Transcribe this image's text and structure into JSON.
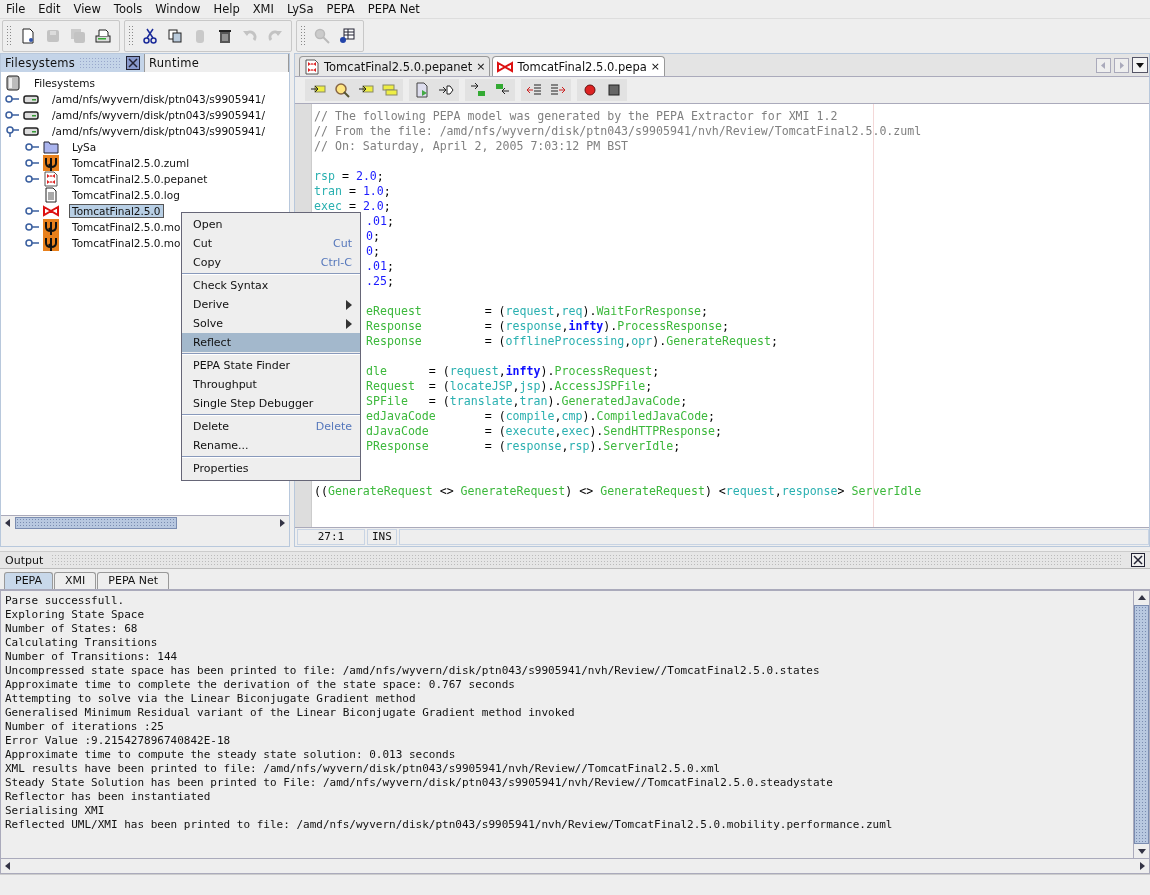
{
  "menubar": [
    "File",
    "Edit",
    "View",
    "Tools",
    "Window",
    "Help",
    "XMI",
    "LySa",
    "PEPA",
    "PEPA Net"
  ],
  "toolbar": {
    "groups": [
      {
        "items": [
          {
            "kind": "new",
            "disabled": false
          },
          {
            "kind": "save",
            "disabled": true
          },
          {
            "kind": "save-all",
            "disabled": true
          },
          {
            "kind": "print",
            "disabled": false
          }
        ]
      },
      {
        "items": [
          {
            "kind": "cut",
            "disabled": false
          },
          {
            "kind": "copy",
            "disabled": false
          },
          {
            "kind": "paste",
            "disabled": true
          },
          {
            "kind": "delete",
            "disabled": false
          },
          {
            "kind": "undo",
            "disabled": true
          },
          {
            "kind": "redo",
            "disabled": true
          }
        ]
      },
      {
        "items": [
          {
            "kind": "find",
            "disabled": true
          },
          {
            "kind": "properties",
            "disabled": false
          }
        ]
      }
    ]
  },
  "explorer": {
    "tabs": [
      {
        "label": "Filesystems",
        "selected": true
      },
      {
        "label": "Runtime",
        "selected": false
      }
    ],
    "tree": [
      {
        "label": "Filesystems",
        "kind": "root",
        "selected": false,
        "children": [
          {
            "label": "/amd/nfs/wyvern/disk/ptn043/s9905941/",
            "kind": "drive",
            "expandable": true,
            "expanded": false,
            "selected": false
          },
          {
            "label": "/amd/nfs/wyvern/disk/ptn043/s9905941/",
            "kind": "drive",
            "expandable": true,
            "expanded": false,
            "selected": false
          },
          {
            "label": "/amd/nfs/wyvern/disk/ptn043/s9905941/",
            "kind": "drive",
            "expandable": true,
            "expanded": true,
            "selected": false,
            "children": [
              {
                "label": "LySa",
                "kind": "folder",
                "expandable": true,
                "expanded": false,
                "selected": false
              },
              {
                "label": "TomcatFinal2.5.0.zuml",
                "kind": "zuml",
                "expandable": true,
                "expanded": false,
                "selected": false
              },
              {
                "label": "TomcatFinal2.5.0.pepanet",
                "kind": "pepanet",
                "expandable": true,
                "expanded": false,
                "selected": false
              },
              {
                "label": "TomcatFinal2.5.0.log",
                "kind": "log",
                "expandable": false,
                "expanded": false,
                "selected": false
              },
              {
                "label": "TomcatFinal2.5.0",
                "kind": "pepa",
                "expandable": true,
                "expanded": false,
                "selected": true
              },
              {
                "label": "TomcatFinal2.5.0.mo",
                "kind": "zuml",
                "expandable": true,
                "expanded": false,
                "selected": false
              },
              {
                "label": "TomcatFinal2.5.0.mo",
                "kind": "zuml",
                "expandable": true,
                "expanded": false,
                "selected": false
              }
            ]
          }
        ]
      }
    ]
  },
  "editor": {
    "tabs": [
      {
        "label": "TomcatFinal2.5.0.pepanet",
        "kind": "pepanet",
        "close": "×",
        "selected": false
      },
      {
        "label": "TomcatFinal2.5.0.pepa",
        "kind": "pepa",
        "close": "×",
        "selected": true
      }
    ],
    "toolbar": [
      {
        "items": [
          {
            "kind": "arrow-tag"
          },
          {
            "kind": "magnifier"
          },
          {
            "kind": "arrow-tag"
          },
          {
            "kind": "stack"
          }
        ]
      },
      {
        "items": [
          {
            "kind": "page-arrow"
          },
          {
            "kind": "arrow-play"
          }
        ]
      },
      {
        "items": [
          {
            "kind": "arrow-down"
          },
          {
            "kind": "arrow-up"
          }
        ]
      },
      {
        "items": [
          {
            "kind": "indent-left"
          },
          {
            "kind": "indent-right"
          }
        ]
      },
      {
        "items": [
          {
            "kind": "record"
          },
          {
            "kind": "stop"
          }
        ]
      }
    ],
    "lines": [
      {
        "kind": "code",
        "tokens": [
          {
            "text": "// The following PEPA model was generated by the PEPA Extractor for XMI 1.2",
            "kind": "comment"
          }
        ]
      },
      {
        "kind": "code",
        "tokens": [
          {
            "text": "// From the file: /amd/nfs/wyvern/disk/ptn043/s9905941/nvh/Review/TomcatFinal2.5.0.zuml",
            "kind": "comment"
          }
        ]
      },
      {
        "kind": "code",
        "tokens": [
          {
            "text": "// On: Saturday, April 2, 2005 7:03:12 PM BST",
            "kind": "comment"
          }
        ]
      },
      {
        "kind": "blank"
      },
      {
        "kind": "code",
        "tokens": [
          {
            "text": "rsp",
            "kind": "rate"
          },
          {
            "text": " = ",
            "kind": "plain"
          },
          {
            "text": "2.0",
            "kind": "num"
          },
          {
            "text": ";",
            "kind": "plain"
          }
        ]
      },
      {
        "kind": "code",
        "tokens": [
          {
            "text": "tran",
            "kind": "rate"
          },
          {
            "text": " = ",
            "kind": "plain"
          },
          {
            "text": "1.0",
            "kind": "num"
          },
          {
            "text": ";",
            "kind": "plain"
          }
        ]
      },
      {
        "kind": "code",
        "tokens": [
          {
            "text": "exec",
            "kind": "rate"
          },
          {
            "text": " = ",
            "kind": "plain"
          },
          {
            "text": "2.0",
            "kind": "num"
          },
          {
            "text": ";",
            "kind": "plain"
          }
        ]
      },
      {
        "kind": "code",
        "clipped": true,
        "tokens": [
          {
            "text": ".01",
            "kind": "num"
          },
          {
            "text": ";",
            "kind": "plain"
          }
        ]
      },
      {
        "kind": "code",
        "clipped": true,
        "tokens": [
          {
            "text": "0",
            "kind": "num"
          },
          {
            "text": ";",
            "kind": "plain"
          }
        ]
      },
      {
        "kind": "code",
        "clipped": true,
        "tokens": [
          {
            "text": "0",
            "kind": "num"
          },
          {
            "text": ";",
            "kind": "plain"
          }
        ]
      },
      {
        "kind": "code",
        "clipped": true,
        "tokens": [
          {
            "text": ".01",
            "kind": "num"
          },
          {
            "text": ";",
            "kind": "plain"
          }
        ]
      },
      {
        "kind": "code",
        "clipped": true,
        "tokens": [
          {
            "text": ".25",
            "kind": "num"
          },
          {
            "text": ";",
            "kind": "plain"
          }
        ]
      },
      {
        "kind": "blank"
      },
      {
        "kind": "code",
        "clipped": true,
        "tokens": [
          {
            "text": "eRequest",
            "kind": "ident"
          },
          {
            "text": "         = (",
            "kind": "plain"
          },
          {
            "text": "request",
            "kind": "rate"
          },
          {
            "text": ",",
            "kind": "plain"
          },
          {
            "text": "req",
            "kind": "rate"
          },
          {
            "text": ").",
            "kind": "plain"
          },
          {
            "text": "WaitForResponse",
            "kind": "ident"
          },
          {
            "text": ";",
            "kind": "plain"
          }
        ]
      },
      {
        "kind": "code",
        "clipped": true,
        "tokens": [
          {
            "text": "Response",
            "kind": "ident"
          },
          {
            "text": "         = (",
            "kind": "plain"
          },
          {
            "text": "response",
            "kind": "rate"
          },
          {
            "text": ",",
            "kind": "plain"
          },
          {
            "text": "infty",
            "kind": "kw"
          },
          {
            "text": ").",
            "kind": "plain"
          },
          {
            "text": "ProcessResponse",
            "kind": "ident"
          },
          {
            "text": ";",
            "kind": "plain"
          }
        ]
      },
      {
        "kind": "code",
        "clipped": true,
        "tokens": [
          {
            "text": "Response",
            "kind": "ident"
          },
          {
            "text": "         = (",
            "kind": "plain"
          },
          {
            "text": "offlineProcessing",
            "kind": "rate"
          },
          {
            "text": ",",
            "kind": "plain"
          },
          {
            "text": "opr",
            "kind": "rate"
          },
          {
            "text": ").",
            "kind": "plain"
          },
          {
            "text": "GenerateRequest",
            "kind": "ident"
          },
          {
            "text": ";",
            "kind": "plain"
          }
        ]
      },
      {
        "kind": "blank"
      },
      {
        "kind": "code",
        "clipped": true,
        "tokens": [
          {
            "text": "dle",
            "kind": "ident"
          },
          {
            "text": "      = (",
            "kind": "plain"
          },
          {
            "text": "request",
            "kind": "rate"
          },
          {
            "text": ",",
            "kind": "plain"
          },
          {
            "text": "infty",
            "kind": "kw"
          },
          {
            "text": ").",
            "kind": "plain"
          },
          {
            "text": "ProcessRequest",
            "kind": "ident"
          },
          {
            "text": ";",
            "kind": "plain"
          }
        ]
      },
      {
        "kind": "code",
        "clipped": true,
        "tokens": [
          {
            "text": "Request",
            "kind": "ident"
          },
          {
            "text": "  = (",
            "kind": "plain"
          },
          {
            "text": "locateJSP",
            "kind": "rate"
          },
          {
            "text": ",",
            "kind": "plain"
          },
          {
            "text": "jsp",
            "kind": "rate"
          },
          {
            "text": ").",
            "kind": "plain"
          },
          {
            "text": "AccessJSPFile",
            "kind": "ident"
          },
          {
            "text": ";",
            "kind": "plain"
          }
        ]
      },
      {
        "kind": "code",
        "clipped": true,
        "tokens": [
          {
            "text": "SPFile",
            "kind": "ident"
          },
          {
            "text": "   = (",
            "kind": "plain"
          },
          {
            "text": "translate",
            "kind": "rate"
          },
          {
            "text": ",",
            "kind": "plain"
          },
          {
            "text": "tran",
            "kind": "rate"
          },
          {
            "text": ").",
            "kind": "plain"
          },
          {
            "text": "GeneratedJavaCode",
            "kind": "ident"
          },
          {
            "text": ";",
            "kind": "plain"
          }
        ]
      },
      {
        "kind": "code",
        "clipped": true,
        "tokens": [
          {
            "text": "edJavaCode",
            "kind": "ident"
          },
          {
            "text": "       = (",
            "kind": "plain"
          },
          {
            "text": "compile",
            "kind": "rate"
          },
          {
            "text": ",",
            "kind": "plain"
          },
          {
            "text": "cmp",
            "kind": "rate"
          },
          {
            "text": ").",
            "kind": "plain"
          },
          {
            "text": "CompiledJavaCode",
            "kind": "ident"
          },
          {
            "text": ";",
            "kind": "plain"
          }
        ]
      },
      {
        "kind": "code",
        "clipped": true,
        "tokens": [
          {
            "text": "dJavaCode",
            "kind": "ident"
          },
          {
            "text": "        = (",
            "kind": "plain"
          },
          {
            "text": "execute",
            "kind": "rate"
          },
          {
            "text": ",",
            "kind": "plain"
          },
          {
            "text": "exec",
            "kind": "rate"
          },
          {
            "text": ").",
            "kind": "plain"
          },
          {
            "text": "SendHTTPResponse",
            "kind": "ident"
          },
          {
            "text": ";",
            "kind": "plain"
          }
        ]
      },
      {
        "kind": "code",
        "clipped": true,
        "tokens": [
          {
            "text": "PResponse",
            "kind": "ident"
          },
          {
            "text": "        = (",
            "kind": "plain"
          },
          {
            "text": "response",
            "kind": "rate"
          },
          {
            "text": ",",
            "kind": "plain"
          },
          {
            "text": "rsp",
            "kind": "rate"
          },
          {
            "text": ").",
            "kind": "plain"
          },
          {
            "text": "ServerIdle",
            "kind": "ident"
          },
          {
            "text": ";",
            "kind": "plain"
          }
        ]
      },
      {
        "kind": "blank"
      },
      {
        "kind": "blank"
      },
      {
        "kind": "code",
        "tokens": [
          {
            "text": "((",
            "kind": "plain"
          },
          {
            "text": "GenerateRequest",
            "kind": "ident"
          },
          {
            "text": " <> ",
            "kind": "plain"
          },
          {
            "text": "GenerateRequest",
            "kind": "ident"
          },
          {
            "text": ") <> ",
            "kind": "plain"
          },
          {
            "text": "GenerateRequest",
            "kind": "ident"
          },
          {
            "text": ") <",
            "kind": "plain"
          },
          {
            "text": "request",
            "kind": "rate"
          },
          {
            "text": ",",
            "kind": "plain"
          },
          {
            "text": "response",
            "kind": "rate"
          },
          {
            "text": "> ",
            "kind": "plain"
          },
          {
            "text": "ServerIdle",
            "kind": "ident"
          }
        ]
      }
    ],
    "status": {
      "position": "27:1",
      "mode": "INS"
    }
  },
  "context_menu": {
    "sections": [
      [
        {
          "label": "Open",
          "submenu": false,
          "selected": false
        },
        {
          "label": "Cut",
          "shortcut": "Cut",
          "submenu": false,
          "selected": false
        },
        {
          "label": "Copy",
          "shortcut": "Ctrl-C",
          "submenu": false,
          "selected": false
        }
      ],
      [
        {
          "label": "Check Syntax",
          "submenu": false,
          "selected": false
        },
        {
          "label": "Derive",
          "submenu": true,
          "selected": false
        },
        {
          "label": "Solve",
          "submenu": true,
          "selected": false
        },
        {
          "label": "Reflect",
          "submenu": false,
          "selected": true
        }
      ],
      [
        {
          "label": "PEPA State Finder",
          "submenu": false,
          "selected": false
        },
        {
          "label": "Throughput",
          "submenu": false,
          "selected": false
        },
        {
          "label": "Single Step Debugger",
          "submenu": false,
          "selected": false
        }
      ],
      [
        {
          "label": "Delete",
          "shortcut": "Delete",
          "submenu": false,
          "selected": false
        },
        {
          "label": "Rename...",
          "submenu": false,
          "selected": false
        }
      ],
      [
        {
          "label": "Properties",
          "submenu": false,
          "selected": false
        }
      ]
    ]
  },
  "output": {
    "title": "Output",
    "tabs": [
      {
        "label": "PEPA",
        "selected": true
      },
      {
        "label": "XMI",
        "selected": false
      },
      {
        "label": "PEPA Net",
        "selected": false
      }
    ],
    "lines": [
      "Parse successfull.",
      "Exploring State Space",
      "Number of States: 68",
      "Calculating Transitions",
      "Number of Transitions: 144",
      "Uncompressed state space has been printed to file: /amd/nfs/wyvern/disk/ptn043/s9905941/nvh/Review//TomcatFinal2.5.0.states",
      "Approximate time to complete the derivation of the state space: 0.767 seconds",
      "Attempting to solve via the Linear Biconjugate Gradient method",
      "Generalised Minimum Residual variant of the Linear Biconjugate Gradient method invoked",
      "Number of iterations :25",
      "Error Value :9.215427896740842E-18",
      "Approximate time to compute the steady state solution: 0.013 seconds",
      "XML results have been printed to file: /amd/nfs/wyvern/disk/ptn043/s9905941/nvh/Review//TomcatFinal2.5.0.xml",
      "Steady State Solution has been printed to File: /amd/nfs/wyvern/disk/ptn043/s9905941/nvh/Review//TomcatFinal2.5.0.steadystate",
      "Reflector has been instantiated",
      "Serialising XMI",
      "Reflected UML/XMI has been printed to file: /amd/nfs/wyvern/disk/ptn043/s9905941/nvh/Review/TomcatFinal2.5.0.mobility.performance.zuml"
    ]
  }
}
